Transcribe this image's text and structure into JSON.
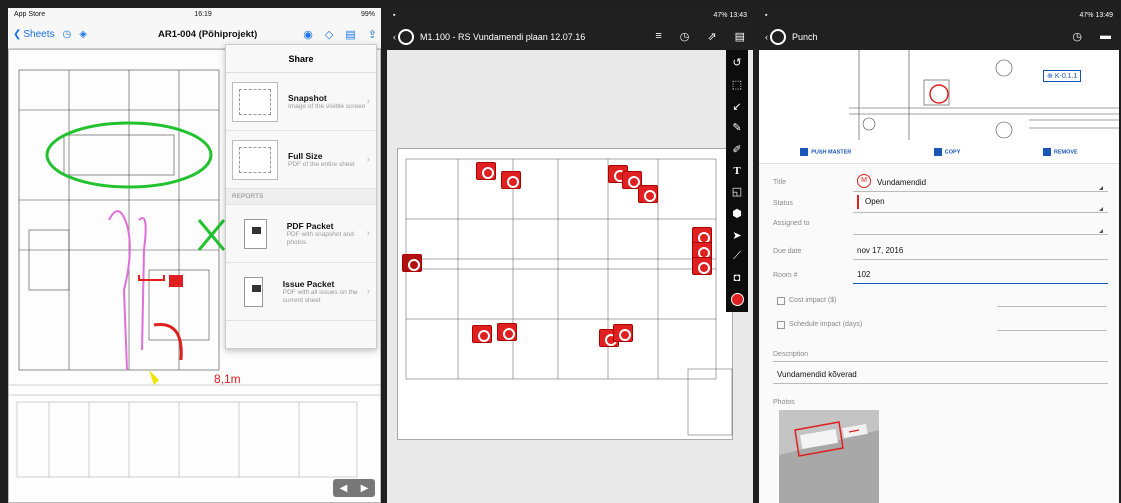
{
  "screen1": {
    "status": {
      "carrier": "App Store",
      "time": "16:19",
      "battery": "99%"
    },
    "nav": {
      "back_label": "Sheets",
      "title": "AR1-004 (Põhiprojekt)"
    },
    "share": {
      "title": "Share",
      "items": [
        {
          "title": "Snapshot",
          "subtitle": "Image of the visible screen"
        },
        {
          "title": "Full Size",
          "subtitle": "PDF of the entire sheet"
        }
      ],
      "section": "REPORTS",
      "reports": [
        {
          "title": "PDF Packet",
          "subtitle": "PDF with snapshot and photos"
        },
        {
          "title": "Issue Packet",
          "subtitle": "PDF with all issues on the current sheet"
        }
      ]
    },
    "markup_dimension": "8,1m"
  },
  "screen2": {
    "status": {
      "battery": "47%",
      "time": "13:43"
    },
    "title": "M1.100 - RS Vundamendi plaan 12.07.16"
  },
  "screen3": {
    "status": {
      "battery": "47%",
      "time": "13:49"
    },
    "title": "Punch",
    "tag": "K-0.1.1",
    "actions": {
      "push_master": "PUSH MASTER",
      "copy": "COPY",
      "remove": "REMOVE"
    },
    "form": {
      "title_label": "Title",
      "title_badge": "M",
      "title_value": "Vundamendid",
      "status_label": "Status",
      "status_value": "Open",
      "assigned_label": "Assigned to",
      "due_label": "Due date",
      "due_value": "nov 17, 2016",
      "room_label": "Room #",
      "room_value": "102",
      "cost_label": "Cost impact ($)",
      "schedule_label": "Schedule impact (days)",
      "description_label": "Description",
      "description_value": "Vundamendid kõverad",
      "photos_label": "Photos"
    },
    "colors": {
      "accent": "#1a56b8",
      "status_open": "#e02020"
    }
  }
}
